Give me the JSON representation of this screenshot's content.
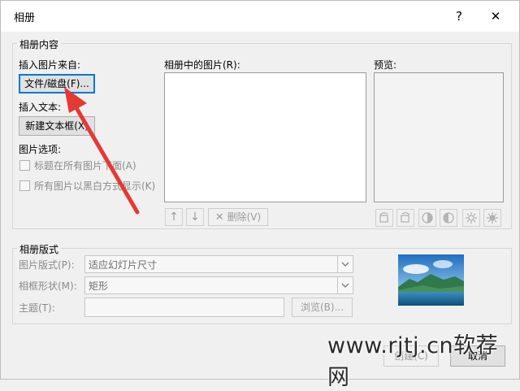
{
  "title": "相册",
  "titlebar": {
    "help": "?",
    "close": "✕"
  },
  "content_group": {
    "label": "相册内容",
    "insert_from": "插入图片来自:",
    "file_button": "文件/磁盘(F)...",
    "insert_text": "插入文本:",
    "new_textbox_button": "新建文本框(X)",
    "picture_options": "图片选项:",
    "opt_caption": "标题在所有图片下面(A)",
    "opt_bw": "所有图片以黑白方式显示(K)",
    "pictures_in_album": "相册中的图片(R):",
    "preview": "预览:",
    "move_up": "↑",
    "move_down": "↓",
    "delete_button": "删除(V)"
  },
  "layout_group": {
    "label": "相册版式",
    "picture_layout_label": "图片版式(P):",
    "picture_layout_value": "适应幻灯片尺寸",
    "frame_shape_label": "相框形状(M):",
    "frame_shape_value": "矩形",
    "theme_label": "主题(T):",
    "theme_value": "",
    "browse_button": "浏览(B)..."
  },
  "footer": {
    "create_button": "创建(C)",
    "cancel_button": "取消"
  },
  "watermark": "www.rjtj.cn软荐网",
  "colors": {
    "accent": "#0078d7",
    "arrow": "#e53935"
  }
}
